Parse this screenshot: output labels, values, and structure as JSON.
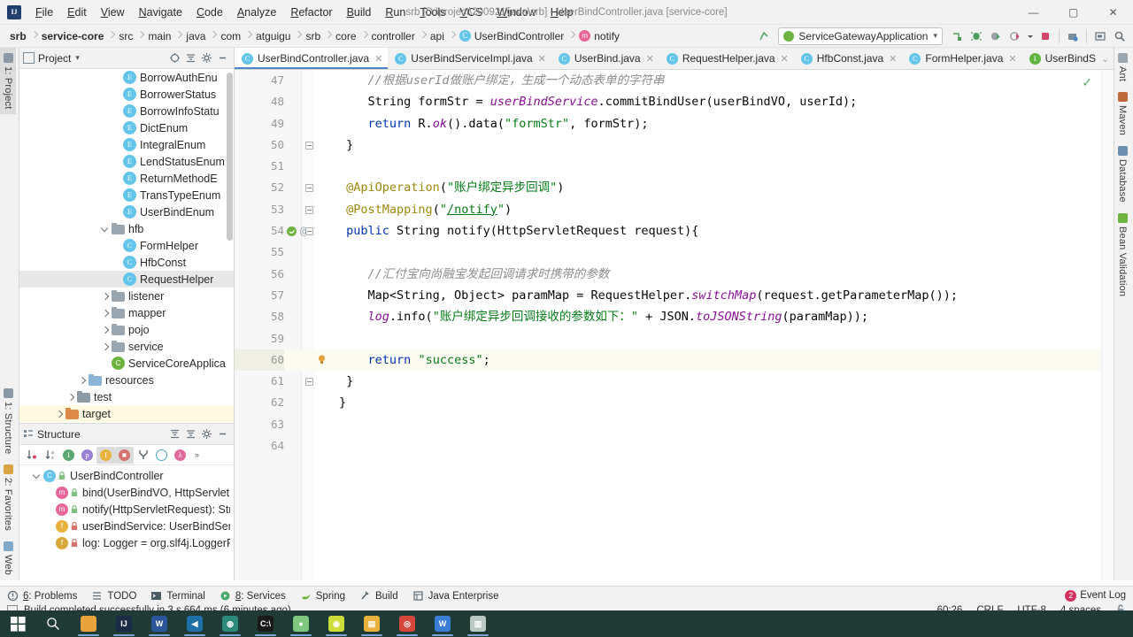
{
  "window": {
    "title": "srb [D:\\project\\200921\\java\\srb] - UserBindController.java [service-core]",
    "minimize": "—",
    "maximize": "▢",
    "close": "✕"
  },
  "menubar": [
    {
      "label": "File"
    },
    {
      "label": "Edit"
    },
    {
      "label": "View"
    },
    {
      "label": "Navigate"
    },
    {
      "label": "Code"
    },
    {
      "label": "Analyze"
    },
    {
      "label": "Refactor"
    },
    {
      "label": "Build"
    },
    {
      "label": "Run"
    },
    {
      "label": "Tools"
    },
    {
      "label": "VCS"
    },
    {
      "label": "Window"
    },
    {
      "label": "Help"
    }
  ],
  "navbar": {
    "crumbs": [
      {
        "label": "srb",
        "bold": true
      },
      {
        "label": "service-core",
        "bold": true
      },
      {
        "label": "src"
      },
      {
        "label": "main"
      },
      {
        "label": "java"
      },
      {
        "label": "com"
      },
      {
        "label": "atguigu"
      },
      {
        "label": "srb"
      },
      {
        "label": "core"
      },
      {
        "label": "controller"
      },
      {
        "label": "api"
      },
      {
        "label": "UserBindController",
        "icon": "class-icon",
        "badge": "C"
      },
      {
        "label": "notify",
        "icon": "method-icon",
        "badge": "m"
      }
    ],
    "run_config": "ServiceGatewayApplication",
    "run_config_caret": "▾",
    "icons": [
      "build-icon",
      "run-icon",
      "debug-icon",
      "run-with-coverage-icon",
      "profile-icon",
      "stop-icon",
      "update-icon",
      "project-structure-icon",
      "settings-icon",
      "search-everywhere-icon"
    ]
  },
  "left_strip": {
    "top": [
      {
        "label": "1: Project",
        "active": true
      }
    ],
    "bottom": [
      {
        "label": "1: Structure"
      },
      {
        "label": "2: Favorites"
      },
      {
        "label": "Web"
      }
    ]
  },
  "right_strip": [
    {
      "label": "Ant"
    },
    {
      "label": "Maven"
    },
    {
      "label": "Database"
    },
    {
      "label": "Bean Validation"
    }
  ],
  "project_panel": {
    "title": "Project",
    "caret": "▾",
    "header_icons": [
      "locate-icon",
      "collapse-all-icon",
      "settings-icon",
      "hide-icon"
    ],
    "tree": [
      {
        "label": "BorrowAuthEnu",
        "indent": 8,
        "icon": "enum",
        "badge": "E"
      },
      {
        "label": "BorrowerStatus",
        "indent": 8,
        "icon": "enum",
        "badge": "E"
      },
      {
        "label": "BorrowInfoStatu",
        "indent": 8,
        "icon": "enum",
        "badge": "E"
      },
      {
        "label": "DictEnum",
        "indent": 8,
        "icon": "enum",
        "badge": "E"
      },
      {
        "label": "IntegralEnum",
        "indent": 8,
        "icon": "enum",
        "badge": "E"
      },
      {
        "label": "LendStatusEnum",
        "indent": 8,
        "icon": "enum",
        "badge": "E"
      },
      {
        "label": "ReturnMethodE",
        "indent": 8,
        "icon": "enum",
        "badge": "E"
      },
      {
        "label": "TransTypeEnum",
        "indent": 8,
        "icon": "enum",
        "badge": "E"
      },
      {
        "label": "UserBindEnum",
        "indent": 8,
        "icon": "enum",
        "badge": "E"
      },
      {
        "label": "hfb",
        "indent": 7,
        "icon": "folder",
        "arrow": "open"
      },
      {
        "label": "FormHelper",
        "indent": 8,
        "icon": "cls",
        "badge": "C"
      },
      {
        "label": "HfbConst",
        "indent": 8,
        "icon": "cls",
        "badge": "C"
      },
      {
        "label": "RequestHelper",
        "indent": 8,
        "icon": "cls",
        "badge": "C",
        "selected": true
      },
      {
        "label": "listener",
        "indent": 7,
        "icon": "folder",
        "arrow": "closed"
      },
      {
        "label": "mapper",
        "indent": 7,
        "icon": "folder",
        "arrow": "closed"
      },
      {
        "label": "pojo",
        "indent": 7,
        "icon": "folder",
        "arrow": "closed"
      },
      {
        "label": "service",
        "indent": 7,
        "icon": "folder",
        "arrow": "closed"
      },
      {
        "label": "ServiceCoreApplica",
        "indent": 7,
        "icon": "spring",
        "badge": "C"
      },
      {
        "label": "resources",
        "indent": 5,
        "icon": "folder-res",
        "arrow": "closed"
      },
      {
        "label": "test",
        "indent": 4,
        "icon": "folder-test",
        "arrow": "closed"
      },
      {
        "label": "target",
        "indent": 3,
        "icon": "folder-target",
        "arrow": "closed",
        "highlight": true
      }
    ]
  },
  "structure_panel": {
    "title": "Structure",
    "header_icons": [
      "expand-all-icon",
      "collapse-all-icon",
      "settings-icon",
      "hide-icon"
    ],
    "toolbar_icons": [
      "sort-by-visibility-icon",
      "sort-alphabetically-icon",
      "show-inherited-icon",
      "show-properties-icon",
      "show-fields-icon",
      "show-non-public-icon",
      "group-by-icon",
      "show-anonymous-icon",
      "show-lambdas-icon",
      "more-icon"
    ],
    "tree": [
      {
        "label": "UserBindController",
        "indent": 1,
        "kind": "class",
        "badge": "C",
        "arrow": "open",
        "lock": "class"
      },
      {
        "label": "bind(UserBindVO, HttpServletRe",
        "indent": 2,
        "kind": "method",
        "badge": "m",
        "lock": "public"
      },
      {
        "label": "notify(HttpServletRequest): Strin",
        "indent": 2,
        "kind": "method",
        "badge": "m",
        "lock": "public"
      },
      {
        "label": "userBindService: UserBindServic",
        "indent": 2,
        "kind": "field",
        "badge": "f",
        "lock": "private"
      },
      {
        "label": "log: Logger = org.slf4j.LoggerF",
        "indent": 2,
        "kind": "static-field",
        "badge": "f",
        "lock": "private"
      }
    ]
  },
  "editor": {
    "tabs": [
      {
        "label": "UserBindController.java",
        "badge": "C",
        "badge_color": "#63c5ea",
        "active": true,
        "close": "✕"
      },
      {
        "label": "UserBindServiceImpl.java",
        "badge": "C",
        "badge_color": "#63c5ea",
        "close": "✕"
      },
      {
        "label": "UserBind.java",
        "badge": "C",
        "badge_color": "#63c5ea",
        "close": "✕"
      },
      {
        "label": "RequestHelper.java",
        "badge": "C",
        "badge_color": "#63c5ea",
        "close": "✕"
      },
      {
        "label": "HfbConst.java",
        "badge": "C",
        "badge_color": "#63c5ea",
        "close": "✕"
      },
      {
        "label": "FormHelper.java",
        "badge": "C",
        "badge_color": "#63c5ea",
        "close": "✕"
      },
      {
        "label": "UserBindS",
        "badge": "I",
        "badge_color": "#62b543",
        "close": "⌄"
      }
    ],
    "inspection_status": "✓",
    "lines": [
      {
        "n": "47",
        "indent": 4,
        "tokens": [
          {
            "t": "//根据userId做账户绑定，生成一个动态表单的字符串",
            "c": "cmt"
          }
        ]
      },
      {
        "n": "48",
        "indent": 4,
        "tokens": [
          {
            "t": "String",
            "c": ""
          },
          {
            "t": " formStr = ",
            "c": ""
          },
          {
            "t": "userBindService",
            "c": "fld"
          },
          {
            "t": ".commitBindUser(userBindVO, userId);",
            "c": ""
          }
        ]
      },
      {
        "n": "49",
        "indent": 4,
        "tokens": [
          {
            "t": "return",
            "c": "kw"
          },
          {
            "t": " R.",
            "c": ""
          },
          {
            "t": "ok",
            "c": "stat"
          },
          {
            "t": "().data(",
            "c": ""
          },
          {
            "t": "\"formStr\"",
            "c": "str"
          },
          {
            "t": ", formStr);",
            "c": ""
          }
        ]
      },
      {
        "n": "50",
        "indent": 1,
        "fold": true,
        "tokens": [
          {
            "t": "}",
            "c": ""
          }
        ]
      },
      {
        "n": "51",
        "indent": 0,
        "tokens": []
      },
      {
        "n": "52",
        "indent": 1,
        "fold": true,
        "tokens": [
          {
            "t": "@ApiOperation",
            "c": "ann"
          },
          {
            "t": "(",
            "c": ""
          },
          {
            "t": "\"账户绑定异步回调\"",
            "c": "str"
          },
          {
            "t": ")",
            "c": ""
          }
        ]
      },
      {
        "n": "53",
        "indent": 1,
        "fold": true,
        "tokens": [
          {
            "t": "@PostMapping",
            "c": "ann"
          },
          {
            "t": "(",
            "c": ""
          },
          {
            "t": "\"",
            "c": "str"
          },
          {
            "t": "/notify",
            "c": "link"
          },
          {
            "t": "\"",
            "c": "str"
          },
          {
            "t": ")",
            "c": ""
          }
        ]
      },
      {
        "n": "54",
        "indent": 1,
        "marker": "spring-bean",
        "fold": true,
        "tokens": [
          {
            "t": "public",
            "c": "kw"
          },
          {
            "t": " String notify(HttpServletRequest request){",
            "c": ""
          }
        ]
      },
      {
        "n": "55",
        "indent": 0,
        "tokens": []
      },
      {
        "n": "56",
        "indent": 4,
        "tokens": [
          {
            "t": "//汇付宝向尚融宝发起回调请求时携带的参数",
            "c": "cmt"
          }
        ]
      },
      {
        "n": "57",
        "indent": 4,
        "tokens": [
          {
            "t": "Map<String, Object> paramMap = RequestHelper.",
            "c": ""
          },
          {
            "t": "switchMap",
            "c": "stat"
          },
          {
            "t": "(request.getParameterMap());",
            "c": ""
          }
        ]
      },
      {
        "n": "58",
        "indent": 4,
        "tokens": [
          {
            "t": "log",
            "c": "fld"
          },
          {
            "t": ".info(",
            "c": ""
          },
          {
            "t": "\"账户绑定异步回调接收的参数如下：\"",
            "c": "str"
          },
          {
            "t": " + JSON.",
            "c": ""
          },
          {
            "t": "toJSONString",
            "c": "stat"
          },
          {
            "t": "(paramMap));",
            "c": ""
          }
        ]
      },
      {
        "n": "59",
        "indent": 0,
        "tokens": []
      },
      {
        "n": "60",
        "indent": 4,
        "highlight": true,
        "bulb": true,
        "tokens": [
          {
            "t": "return",
            "c": "kw"
          },
          {
            "t": " ",
            "c": ""
          },
          {
            "t": "\"success\"",
            "c": "str"
          },
          {
            "t": ";",
            "c": ""
          }
        ]
      },
      {
        "n": "61",
        "indent": 1,
        "fold": true,
        "tokens": [
          {
            "t": "}",
            "c": ""
          }
        ]
      },
      {
        "n": "62",
        "indent": 0,
        "tokens": [
          {
            "t": "}",
            "c": ""
          }
        ]
      },
      {
        "n": "63",
        "indent": 0,
        "tokens": []
      },
      {
        "n": "64",
        "indent": 0,
        "tokens": []
      }
    ]
  },
  "toolwindow_bar": [
    {
      "label": "6: Problems",
      "mnemonic": "6",
      "icon": "problems-icon"
    },
    {
      "label": "TODO",
      "icon": "todo-icon"
    },
    {
      "label": "Terminal",
      "icon": "terminal-icon"
    },
    {
      "label": "8: Services",
      "mnemonic": "8",
      "icon": "services-icon"
    },
    {
      "label": "Spring",
      "icon": "spring-icon"
    },
    {
      "label": "Build",
      "icon": "build-icon"
    },
    {
      "label": "Java Enterprise",
      "icon": "java-enterprise-icon"
    }
  ],
  "status_bar": {
    "message": "Build completed successfully in 3 s 664 ms (6 minutes ago)",
    "event_log": "Event Log",
    "event_count": "2",
    "caret_position": "60:26",
    "line_separator": "CRLF",
    "encoding": "UTF-8",
    "indent": "4 spaces",
    "lock_icon": "read-write-icon"
  },
  "taskbar": {
    "items": [
      {
        "name": "start-button",
        "glyph": "⊞",
        "color": "#1f3b36",
        "text": "#ffffff"
      },
      {
        "name": "search-icon",
        "glyph": "○",
        "color": "#1f3b36",
        "text": "#ffffff"
      },
      {
        "name": "app-icon-1",
        "glyph": "",
        "color": "#e8a33d",
        "text": "#ffffff",
        "open": true
      },
      {
        "name": "intellij-idea-icon",
        "glyph": "IJ",
        "color": "#1b2a47",
        "text": "#ffffff",
        "open": true
      },
      {
        "name": "word-icon",
        "glyph": "W",
        "color": "#2b579a",
        "text": "#ffffff",
        "open": true
      },
      {
        "name": "vscode-icon",
        "glyph": "◀",
        "color": "#1f6fa8",
        "text": "#ffffff",
        "open": true
      },
      {
        "name": "app-icon-2",
        "glyph": "◍",
        "color": "#2b8a7a",
        "text": "#ffffff",
        "open": true
      },
      {
        "name": "cmd-icon",
        "glyph": "C:\\",
        "color": "#1a1a1a",
        "text": "#ffffff",
        "open": true
      },
      {
        "name": "app-icon-3",
        "glyph": "●",
        "color": "#7fc97f",
        "text": "#ffffff",
        "open": true
      },
      {
        "name": "app-icon-4",
        "glyph": "◉",
        "color": "#cddc39",
        "text": "#ffffff",
        "open": true
      },
      {
        "name": "explorer-icon",
        "glyph": "▤",
        "color": "#e8b23d",
        "text": "#ffffff",
        "open": true
      },
      {
        "name": "chrome-icon",
        "glyph": "◎",
        "color": "#d8453a",
        "text": "#ffffff",
        "open": true
      },
      {
        "name": "wps-icon",
        "glyph": "W",
        "color": "#3a7fd5",
        "text": "#ffffff",
        "open": true
      },
      {
        "name": "notepad-icon",
        "glyph": "▥",
        "color": "#b9c9c3",
        "text": "#ffffff",
        "open": true
      }
    ]
  }
}
